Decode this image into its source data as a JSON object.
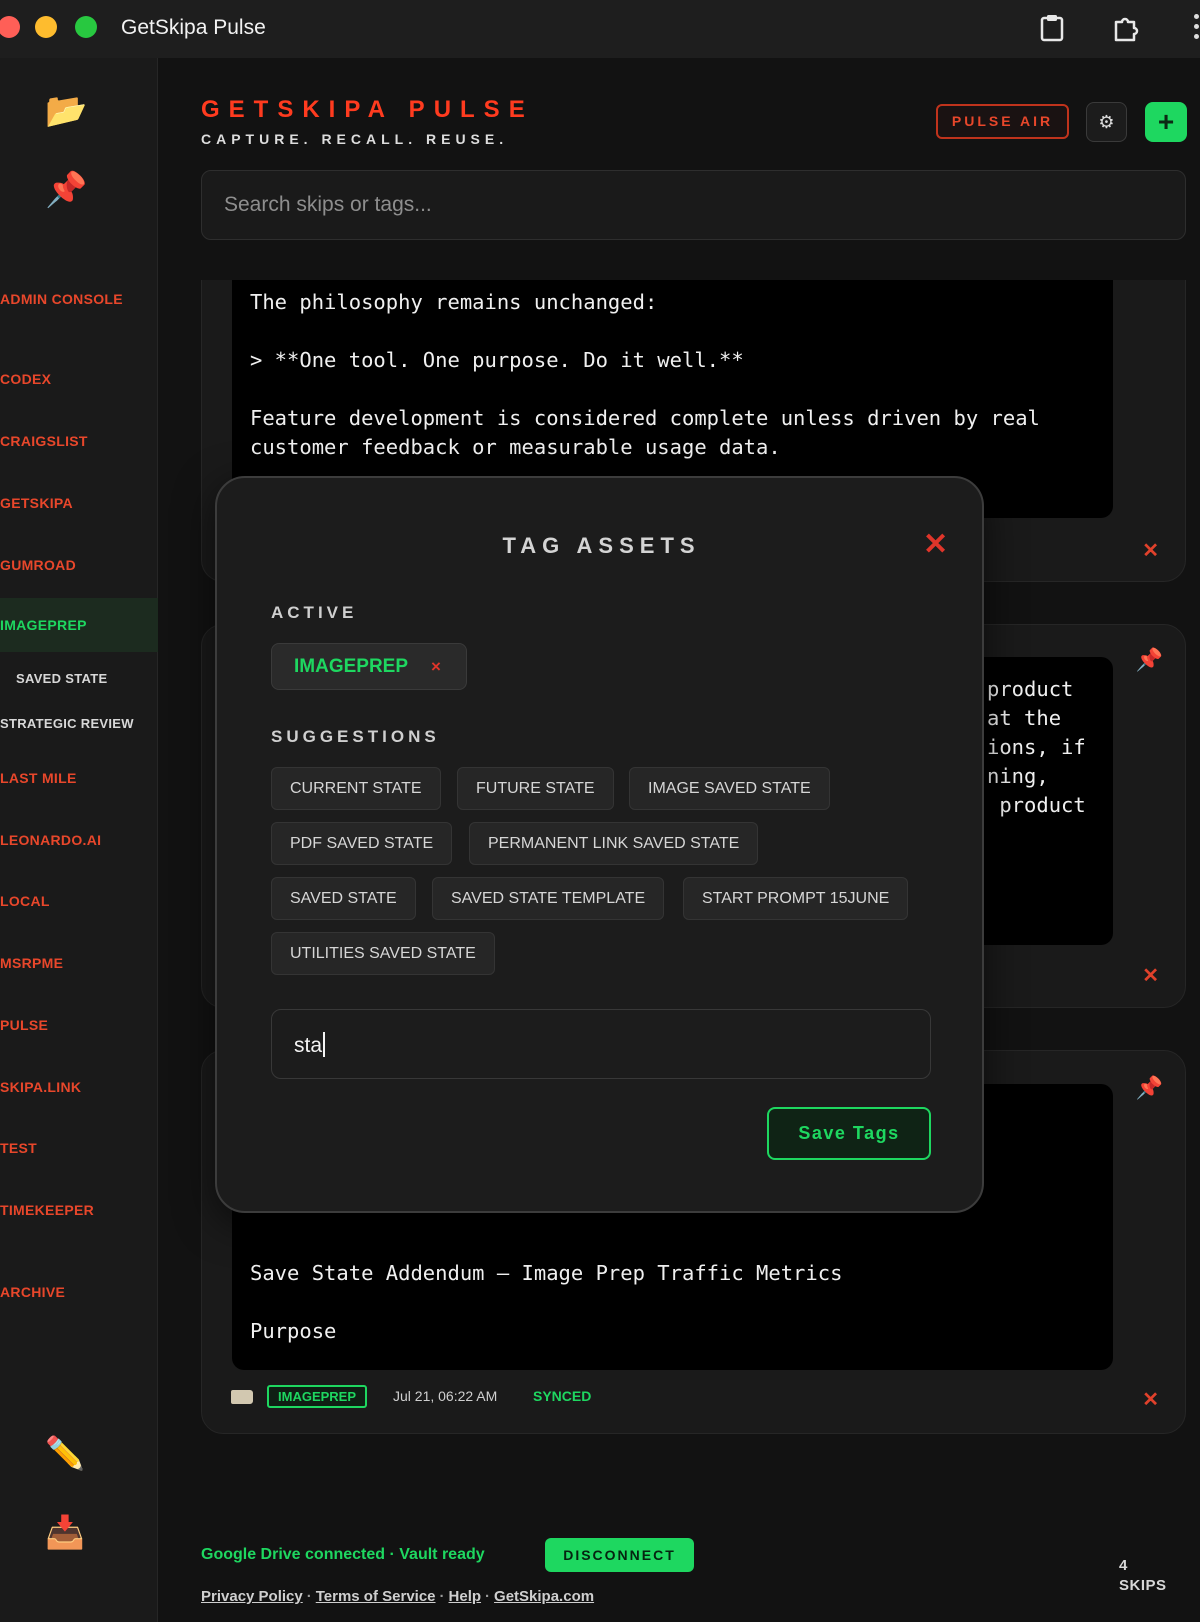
{
  "window": {
    "title": "GetSkipa Pulse"
  },
  "header": {
    "brand": "GETSKIPA PULSE",
    "tagline": "CAPTURE. RECALL. REUSE.",
    "pulse_air_label": "PULSE AIR",
    "settings_icon": "⚙",
    "add_icon": "+"
  },
  "search": {
    "placeholder": "Search skips or tags..."
  },
  "sidebar": {
    "items": [
      {
        "label": "ADMIN CONSOLE"
      },
      {
        "label": "CODEX"
      },
      {
        "label": "CRAIGSLIST"
      },
      {
        "label": "GETSKIPA"
      },
      {
        "label": "GUMROAD"
      },
      {
        "label": "IMAGEPREP"
      },
      {
        "label": "LAST MILE"
      },
      {
        "label": "LEONARDO.AI"
      },
      {
        "label": "LOCAL"
      },
      {
        "label": "MSRPME"
      },
      {
        "label": "PULSE"
      },
      {
        "label": "SKIPA.LINK"
      },
      {
        "label": "TEST"
      },
      {
        "label": "TIMEKEEPER"
      },
      {
        "label": "ARCHIVE"
      }
    ],
    "sub_items": [
      {
        "label": "SAVED STATE"
      },
      {
        "label": "STRATEGIC REVIEW"
      }
    ]
  },
  "cards": [
    {
      "body": "The philosophy remains unchanged:\n\n> **One tool. One purpose. Do it well.**\n\nFeature development is considered complete unless driven by real\ncustomer feedback or measurable usage data."
    },
    {
      "body": "product\nat the\nions, if\nning,\n product"
    },
    {
      "body": "Save State Addendum — Image Prep Traffic Metrics\n\nPurpose\n\nImplement a minimal, privacy-conscious traffic counter to",
      "tag": "IMAGEPREP",
      "date": "Jul 21, 06:22 AM",
      "status": "SYNCED"
    }
  ],
  "footer": {
    "status": "Google Drive connected · Vault ready",
    "disconnect_label": "DISCONNECT",
    "links": [
      "Privacy Policy",
      "Terms of Service",
      "Help",
      "GetSkipa.com"
    ],
    "skips_count": "4",
    "skips_label": "SKIPS"
  },
  "modal": {
    "title": "TAG ASSETS",
    "active_label": "ACTIVE",
    "active_tags": [
      "IMAGEPREP"
    ],
    "suggestions_label": "SUGGESTIONS",
    "suggestions": [
      "CURRENT STATE",
      "FUTURE STATE",
      "IMAGE SAVED STATE",
      "PDF SAVED STATE",
      "PERMANENT LINK SAVED STATE",
      "SAVED STATE",
      "SAVED STATE TEMPLATE",
      "START PROMPT 15JUNE",
      "UTILITIES SAVED STATE"
    ],
    "input_value": "sta",
    "save_label": "Save Tags"
  },
  "colors": {
    "accent_green": "#1ed760",
    "accent_red": "#e8472b",
    "brand_orange": "#ff3b1f"
  }
}
